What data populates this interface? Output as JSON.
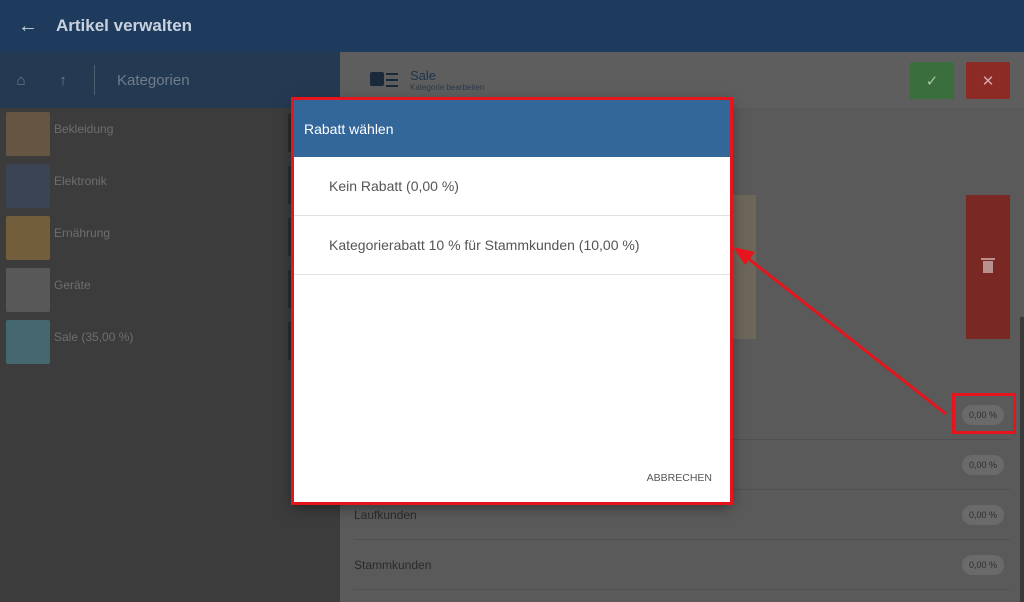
{
  "appbar": {
    "back_icon": "arrow-left-icon",
    "title": "Artikel verwalten"
  },
  "left_toolbar": {
    "home_icon": "home-icon",
    "up_icon": "arrow-up-icon",
    "label": "Kategorien"
  },
  "categories": [
    {
      "name": "Bekleidung",
      "thumb_color": "#8a6a4a"
    },
    {
      "name": "Elektronik",
      "thumb_color": "#3a4a6a"
    },
    {
      "name": "Ernährung",
      "thumb_color": "#a07a3a"
    },
    {
      "name": "Geräte",
      "thumb_color": "#707070"
    },
    {
      "name": "Sale (35,00 %)",
      "thumb_color": "#4a8a9a"
    }
  ],
  "editor": {
    "title": "Sale",
    "subtitle": "Kategorie bearbeiten",
    "ok_icon": "check-icon",
    "cancel_icon": "close-icon",
    "delete_icon": "trash-icon"
  },
  "discount_rows": [
    {
      "label": "",
      "value": "0,00 %"
    },
    {
      "label": "",
      "value": "0,00 %"
    },
    {
      "label": "Laufkunden",
      "value": "0,00 %"
    },
    {
      "label": "Stammkunden",
      "value": "0,00 %"
    }
  ],
  "dialog": {
    "title": "Rabatt wählen",
    "options": [
      "Kein Rabatt (0,00 %)",
      "Kategorierabatt 10 % für Stammkunden (10,00 %)"
    ],
    "cancel_label": "ABBRECHEN"
  },
  "colors": {
    "appbar": "#1e3a5c",
    "dialog_header": "#336699",
    "annotation": "#e6141c"
  }
}
